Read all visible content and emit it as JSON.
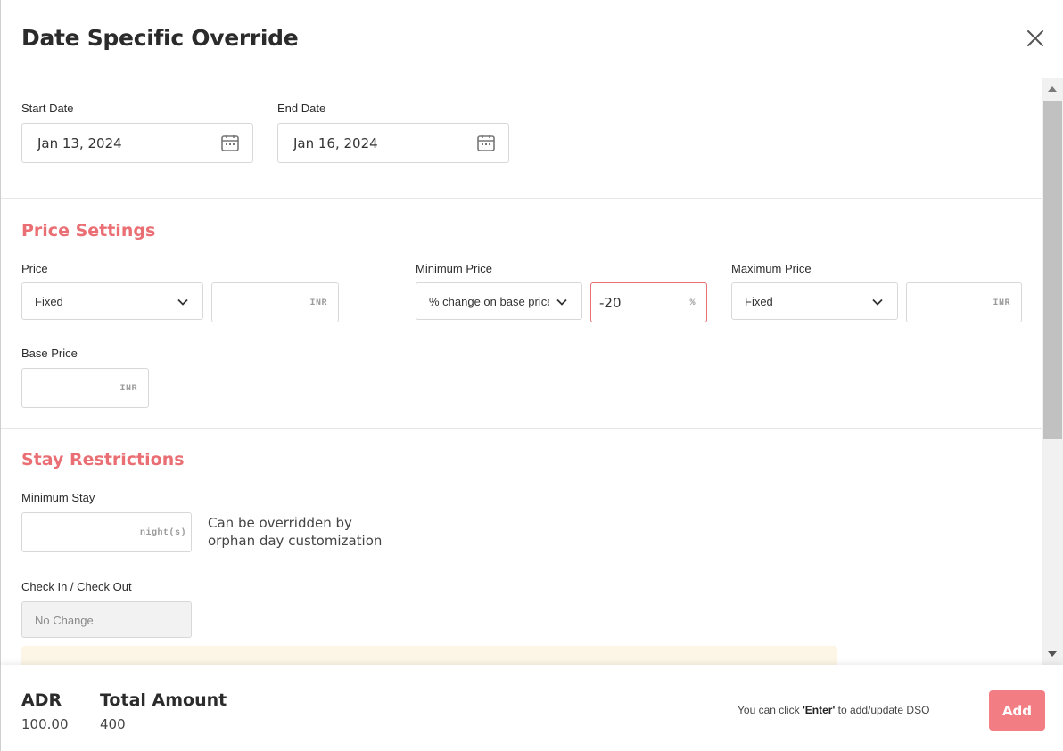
{
  "dialog": {
    "title": "Date Specific Override"
  },
  "dates": {
    "start_label": "Start Date",
    "start_value": "Jan 13, 2024",
    "end_label": "End Date",
    "end_value": "Jan 16, 2024"
  },
  "price_settings": {
    "section_title": "Price Settings",
    "price": {
      "label": "Price",
      "mode": "Fixed",
      "value": "",
      "unit": "INR"
    },
    "min_price": {
      "label": "Minimum Price",
      "mode": "% change on base price",
      "value": "-20",
      "unit": "%"
    },
    "max_price": {
      "label": "Maximum Price",
      "mode": "Fixed",
      "value": "",
      "unit": "INR"
    },
    "base_price": {
      "label": "Base Price",
      "value": "",
      "unit": "INR"
    }
  },
  "stay_restrictions": {
    "section_title": "Stay Restrictions",
    "min_stay": {
      "label": "Minimum Stay",
      "value": "",
      "unit": "night(s)",
      "note_line1": "Can be overridden by",
      "note_line2": "orphan day customization"
    },
    "check_in_out": {
      "label": "Check In / Check Out",
      "value": "No Change"
    }
  },
  "footer": {
    "adr_label": "ADR",
    "adr_value": "100.00",
    "total_label": "Total Amount",
    "total_value": "400",
    "hint_prefix": "You can click ",
    "hint_key": "'Enter'",
    "hint_suffix": " to add/update DSO",
    "add_label": "Add"
  },
  "colors": {
    "accent": "#ea6f74",
    "button": "#f27d82",
    "warning_bg": "#fdf6e6"
  }
}
